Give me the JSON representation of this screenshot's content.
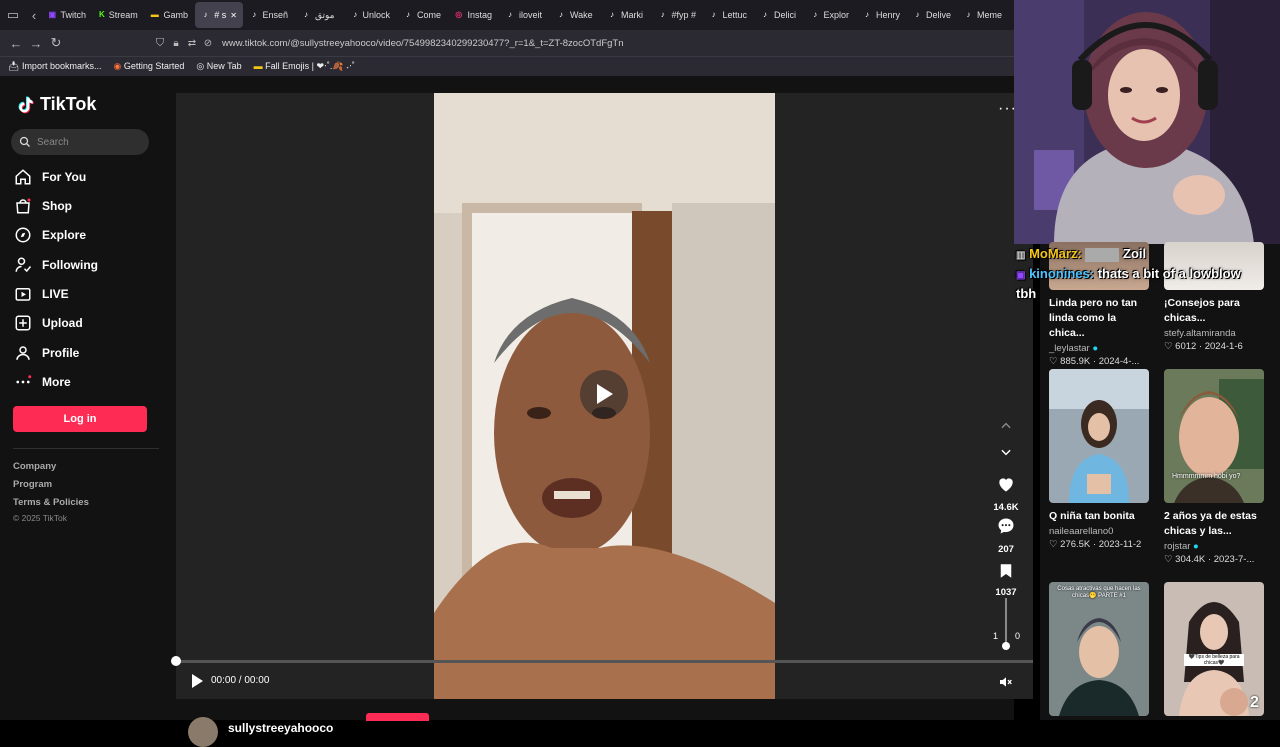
{
  "browser": {
    "tabs": [
      {
        "label": "Twitch",
        "color": "#9146ff",
        "glyph": "▣"
      },
      {
        "label": "Stream",
        "color": "#53fc18",
        "glyph": "K"
      },
      {
        "label": "Gamb",
        "color": "#f5c518",
        "glyph": "▬"
      },
      {
        "label": "# s",
        "color": "#ffffff",
        "glyph": "♪",
        "active": true
      },
      {
        "label": "Enseñ",
        "color": "#ffffff",
        "glyph": "♪"
      },
      {
        "label": "موتق",
        "color": "#ffffff",
        "glyph": "♪"
      },
      {
        "label": "Unlock",
        "color": "#ffffff",
        "glyph": "♪"
      },
      {
        "label": "Come",
        "color": "#ffffff",
        "glyph": "♪"
      },
      {
        "label": "Instag",
        "color": "#e1306c",
        "glyph": "◎"
      },
      {
        "label": "iloveit",
        "color": "#ffffff",
        "glyph": "♪"
      },
      {
        "label": "Wake",
        "color": "#ffffff",
        "glyph": "♪"
      },
      {
        "label": "Marki",
        "color": "#ffffff",
        "glyph": "♪"
      },
      {
        "label": "#fyp #",
        "color": "#ffffff",
        "glyph": "♪"
      },
      {
        "label": "Lettuc",
        "color": "#ffffff",
        "glyph": "♪"
      },
      {
        "label": "Delici",
        "color": "#ffffff",
        "glyph": "♪"
      },
      {
        "label": "Explor",
        "color": "#ffffff",
        "glyph": "♪"
      },
      {
        "label": "Henry",
        "color": "#ffffff",
        "glyph": "♪"
      },
      {
        "label": "Delive",
        "color": "#ffffff",
        "glyph": "♪"
      },
      {
        "label": "Meme",
        "color": "#ffffff",
        "glyph": "♪"
      }
    ],
    "url": "www.tiktok.com/@sullystreeyahooco/video/7549982340299230477?_r=1&_t=ZT-8zocOTdFgTn",
    "bookmarks": [
      "Import bookmarks...",
      "Getting Started",
      "New Tab",
      "Fall Emojis | ❤‧˚.🍂 ˖‧˚"
    ]
  },
  "sidebar": {
    "logo": "TikTok",
    "search_placeholder": "Search",
    "menu": [
      {
        "label": "For You",
        "icon": "home-icon"
      },
      {
        "label": "Shop",
        "icon": "shop-icon"
      },
      {
        "label": "Explore",
        "icon": "compass-icon"
      },
      {
        "label": "Following",
        "icon": "following-icon"
      },
      {
        "label": "LIVE",
        "icon": "live-icon"
      },
      {
        "label": "Upload",
        "icon": "upload-icon"
      },
      {
        "label": "Profile",
        "icon": "profile-icon"
      },
      {
        "label": "More",
        "icon": "more-icon"
      }
    ],
    "login": "Log in",
    "footer": [
      "Company",
      "Program",
      "Terms & Policies"
    ],
    "copyright": "© 2025 TikTok"
  },
  "player": {
    "time": "00:00 / 00:00",
    "likes": "14.6K",
    "comments": "207",
    "saves": "1037",
    "username": "sullystreeyahooco",
    "progress": 0,
    "volume_left": "1",
    "volume_right": "0"
  },
  "recommendations": [
    {
      "title": "Linda pero no tan linda como la chica...",
      "user": "_leylastar",
      "verified": true,
      "stats": "♡ 885.9K · 2024-4-..."
    },
    {
      "title": "¡Consejos para chicas...",
      "user": "stefy.altamiranda",
      "verified": false,
      "stats": "♡ 6012 · 2024-1-6"
    },
    {
      "title": "Q niña tan bonita",
      "user": "naileaarellano0",
      "verified": false,
      "stats": "♡ 276.5K · 2023-11-2"
    },
    {
      "title": "2 años ya de estas chicas y las...",
      "user": "rojstar",
      "verified": true,
      "stats": "♡ 304.4K · 2023-7-..."
    }
  ],
  "thumb_texts": {
    "hmm": "Hmmmmmm hobi yo?",
    "tips": "🖤Tips de belleza para chicas🖤",
    "cosas": "Cosas atractivas que hacen las chicas🫢 PARTE #1",
    "two": "2"
  },
  "chat": [
    {
      "user": "MoMarz:",
      "msg": "Zoil",
      "color": "#f5c518"
    },
    {
      "user": "kinonines:",
      "msg": "thats a bit of a lowblow",
      "color": "#4fc3ff"
    },
    {
      "user": "",
      "msg": "tbh",
      "color": "#ffffff"
    }
  ]
}
